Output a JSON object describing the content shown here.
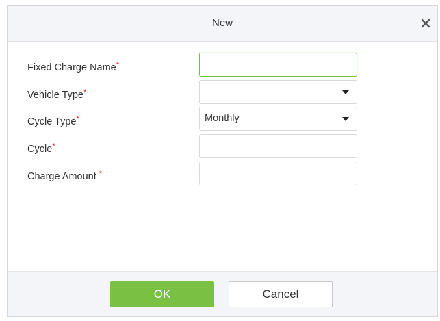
{
  "dialog": {
    "title": "New",
    "close_icon": "close-icon"
  },
  "form": {
    "fields": [
      {
        "label": "Fixed Charge Name",
        "required_mark": "*",
        "type": "text",
        "value": "",
        "focused": true
      },
      {
        "label": "Vehicle Type",
        "required_mark": "*",
        "type": "select",
        "value": ""
      },
      {
        "label": "Cycle Type",
        "required_mark": "*",
        "type": "select",
        "value": "Monthly"
      },
      {
        "label": "Cycle",
        "required_mark": "*",
        "type": "text",
        "value": ""
      },
      {
        "label": "Charge Amount ",
        "required_mark": "*",
        "type": "text",
        "value": ""
      }
    ]
  },
  "footer": {
    "ok_label": "OK",
    "cancel_label": "Cancel"
  },
  "colors": {
    "accent": "#7ac143",
    "required": "#e02020",
    "header_bg": "#f3f5f8"
  }
}
